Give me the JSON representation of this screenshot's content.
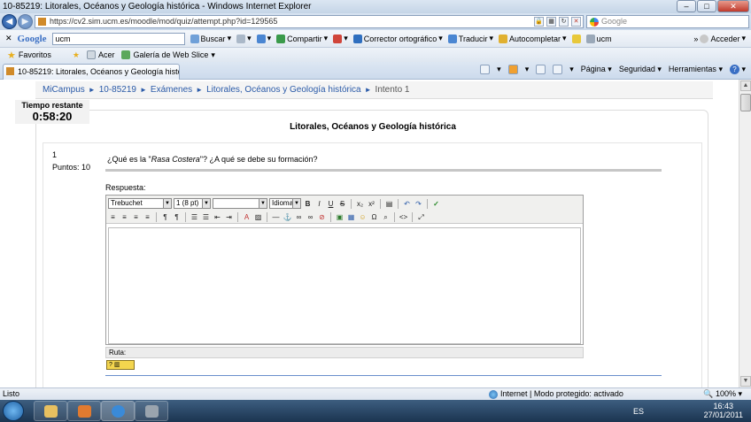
{
  "window": {
    "title": "10-85219: Litorales, Océanos y Geología histórica - Windows Internet Explorer",
    "btn_min": "–",
    "btn_max": "□",
    "btn_close": "✕"
  },
  "address": {
    "back": "◀",
    "forward": "▶",
    "url": "https://cv2.sim.ucm.es/moodle/mod/quiz/attempt.php?id=129565",
    "search_placeholder": "Google"
  },
  "google_toolbar": {
    "close": "✕",
    "logo": "Google",
    "query": "ucm",
    "search_btn": "Buscar",
    "share": "Compartir",
    "spell": "Corrector ortográfico",
    "translate": "Traducir",
    "autofill": "Autocompletar",
    "term": "ucm",
    "signin": "Acceder"
  },
  "favorites_bar": {
    "favorites": "Favoritos",
    "acer": "Acer",
    "webslice": "Galería de Web Slice"
  },
  "tab": {
    "title": "10-85219: Litorales, Océanos y Geología histórica"
  },
  "command_bar": {
    "page": "Página",
    "security": "Seguridad",
    "tools": "Herramientas",
    "help": "?"
  },
  "breadcrumb": {
    "items": [
      "MiCampus",
      "10-85219",
      "Exámenes",
      "Litorales, Océanos y Geología histórica"
    ],
    "current": "Intento 1",
    "separator": "►"
  },
  "timer": {
    "label": "Tiempo restante",
    "value": "0:58:20"
  },
  "quiz": {
    "title": "Litorales, Océanos y Geología histórica",
    "question_number": "1",
    "points": "Puntos: 10",
    "question_before": "¿Qué es la \"",
    "question_italic": "Rasa Costera",
    "question_after": "\"? ¿A qué se debe su formación?",
    "answer_label": "Respuesta:"
  },
  "editor": {
    "font": "Trebuchet",
    "size": "1 (8 pt)",
    "style": "",
    "language": "Idioma",
    "status_path": "Ruta:",
    "help_badge": "?"
  },
  "statusbar": {
    "status": "Listo",
    "zone": "Internet | Modo protegido: activado",
    "zoom": "100%"
  },
  "taskbar": {
    "lang": "ES",
    "time": "16:43",
    "date": "27/01/2011"
  }
}
